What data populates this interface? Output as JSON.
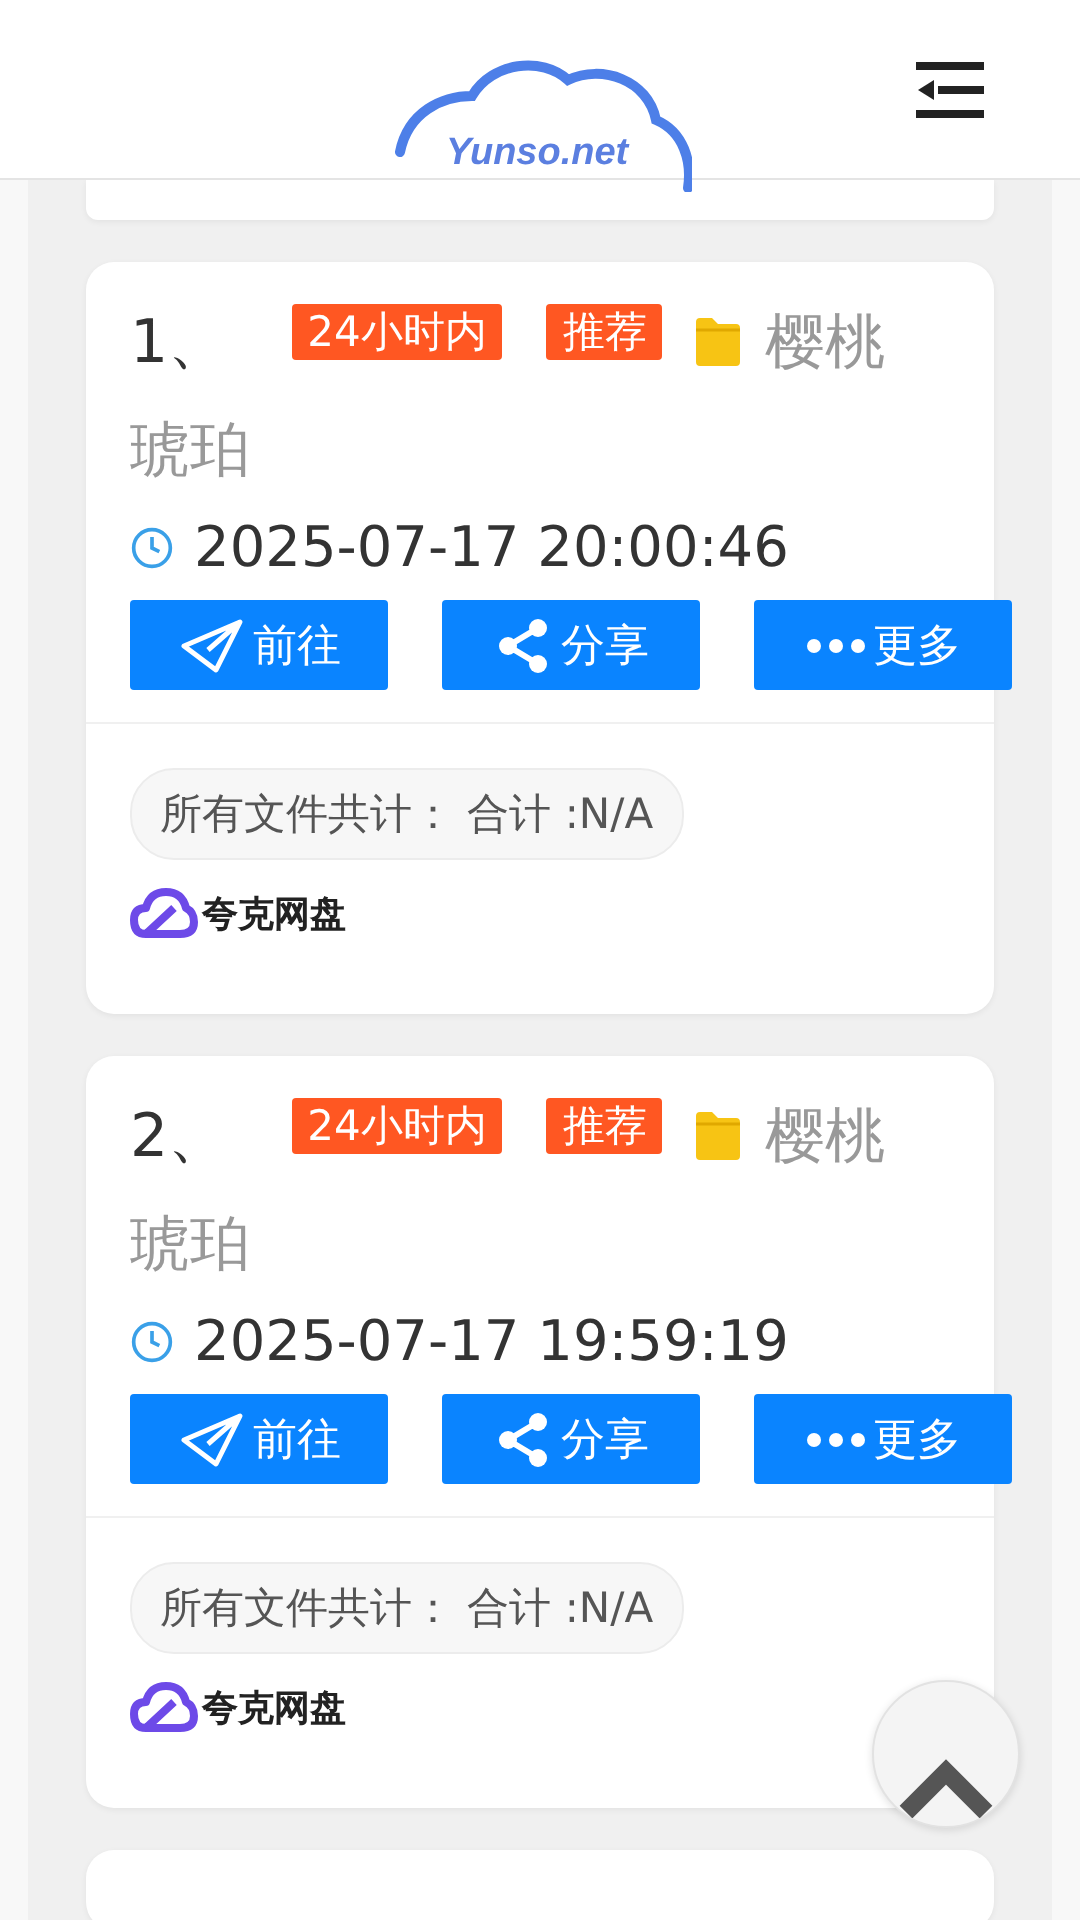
{
  "header": {
    "logo_text": "Yunso.net"
  },
  "results": [
    {
      "index": "1、",
      "tags": [
        "24小时内",
        "推荐"
      ],
      "title_lines": [
        "樱桃",
        "琥珀"
      ],
      "time": "2025-07-17 20:00:46",
      "actions": [
        {
          "kind": "go",
          "label": "前往"
        },
        {
          "kind": "share",
          "label": "分享"
        },
        {
          "kind": "more",
          "label": "更多"
        }
      ],
      "summary": "所有文件共计： 合计 :N/A",
      "source": "夸克网盘"
    },
    {
      "index": "2、",
      "tags": [
        "24小时内",
        "推荐"
      ],
      "title_lines": [
        "樱桃",
        "琥珀"
      ],
      "time": "2025-07-17 19:59:19",
      "actions": [
        {
          "kind": "go",
          "label": "前往"
        },
        {
          "kind": "share",
          "label": "分享"
        },
        {
          "kind": "more",
          "label": "更多"
        }
      ],
      "summary": "所有文件共计： 合计 :N/A",
      "source": "夸克网盘"
    }
  ]
}
